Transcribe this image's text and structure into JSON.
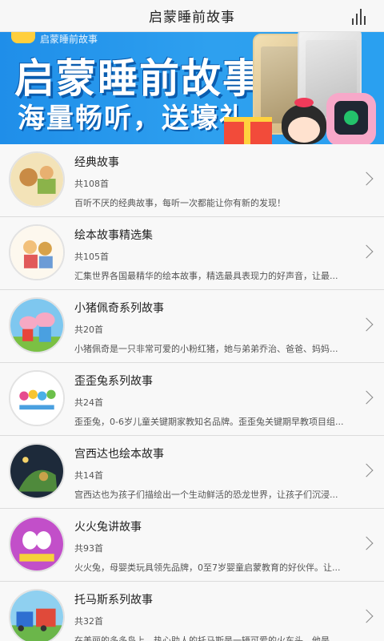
{
  "header": {
    "title": "启蒙睡前故事",
    "menu_icon": "bars-icon"
  },
  "banner": {
    "tag": "启蒙睡前故事",
    "title": "启蒙睡前故事",
    "subtitle": "海量畅听，送壕礼"
  },
  "stories": [
    {
      "title": "经典故事",
      "count": "共108首",
      "desc": "百听不厌的经典故事，每听一次都能让你有新的发现！"
    },
    {
      "title": "绘本故事精选集",
      "count": "共105首",
      "desc": "汇集世界各国最精华的绘本故事，精选最具表现力的好声音，让最..."
    },
    {
      "title": "小猪佩奇系列故事",
      "count": "共20首",
      "desc": "小猪佩奇是一只非常可爱的小粉红猪，她与弟弟乔治、爸爸、妈妈..."
    },
    {
      "title": "歪歪兔系列故事",
      "count": "共24首",
      "desc": "歪歪兔，0-6岁儿童关键期家教知名品牌。歪歪兔关键期早教项目组..."
    },
    {
      "title": "宫西达也绘本故事",
      "count": "共14首",
      "desc": "宫西达也为孩子们描绘出一个生动鲜活的恐龙世界，让孩子们沉浸..."
    },
    {
      "title": "火火兔讲故事",
      "count": "共93首",
      "desc": "火火兔，母婴类玩具领先品牌，0至7岁婴童启蒙教育的好伙伴。让..."
    },
    {
      "title": "托马斯系列故事",
      "count": "共32首",
      "desc": "在美丽的多多岛上，热心助人的托马斯是一辆可爱的火车头，他是..."
    }
  ],
  "colors": {
    "banner_blue": "#2a9bef",
    "row_bg": "#f8f8f8"
  }
}
